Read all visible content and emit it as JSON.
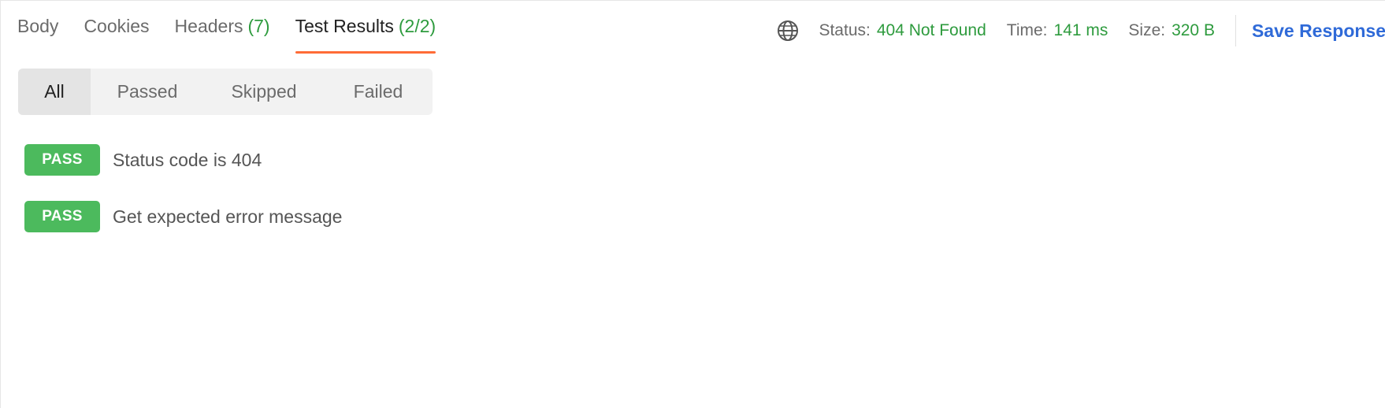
{
  "tabs": [
    {
      "label": "Body",
      "count": ""
    },
    {
      "label": "Cookies",
      "count": ""
    },
    {
      "label": "Headers",
      "count": "(7)"
    },
    {
      "label": "Test Results",
      "count": "(2/2)"
    }
  ],
  "active_tab": "Test Results",
  "status_bar": {
    "status_label": "Status:",
    "status_value": "404 Not Found",
    "time_label": "Time:",
    "time_value": "141 ms",
    "size_label": "Size:",
    "size_value": "320 B",
    "save_label": "Save Response",
    "globe_icon": "globe-icon"
  },
  "filters": [
    "All",
    "Passed",
    "Skipped",
    "Failed"
  ],
  "active_filter": "All",
  "results": [
    {
      "badge": "PASS",
      "name": "Status code is 404"
    },
    {
      "badge": "PASS",
      "name": "Get expected error message"
    }
  ],
  "colors": {
    "accent_underline": "#ff6c37",
    "status_green": "#2e9b3e",
    "pass_badge": "#4cba5d",
    "save_link": "#2f6ad8"
  }
}
